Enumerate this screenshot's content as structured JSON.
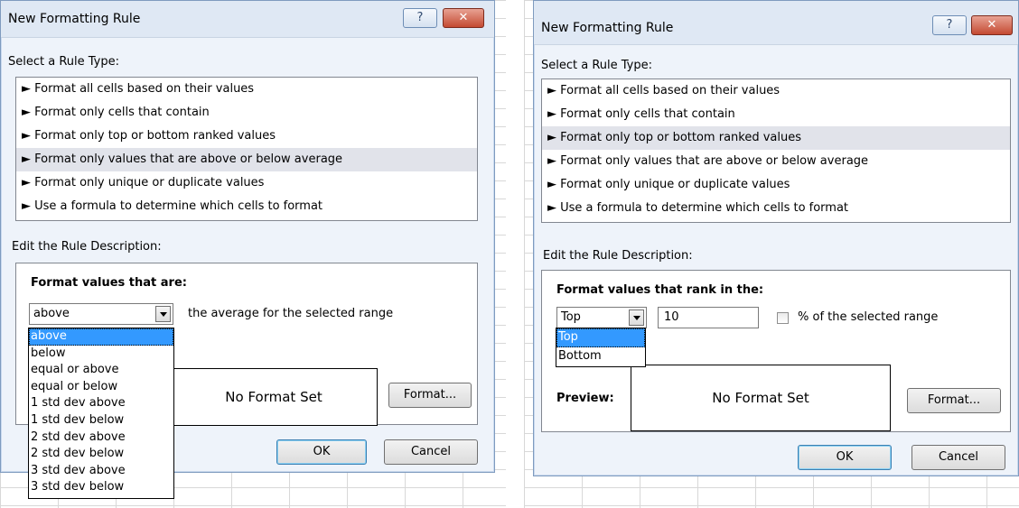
{
  "dialog1": {
    "title": "New Formatting Rule",
    "help": "?",
    "close": "✕",
    "select_rule_type": "Select a Rule Type:",
    "rule_types": [
      "► Format all cells based on their values",
      "► Format only cells that contain",
      "► Format only top or bottom ranked values",
      "► Format only values that are above or below average",
      "► Format only unique or duplicate values",
      "► Use a formula to determine which cells to format"
    ],
    "edit_rule_desc": "Edit the Rule Description:",
    "format_values_label": "Format values that are:",
    "combo_value": "above",
    "combo_suffix": "the average for the selected range",
    "dropdown_options": [
      "above",
      "below",
      "equal or above",
      "equal or below",
      "1 std dev above",
      "1 std dev below",
      "2 std dev above",
      "2 std dev below",
      "3 std dev above",
      "3 std dev below"
    ],
    "preview_text": "No Format Set",
    "format_button": "Format...",
    "ok": "OK",
    "cancel": "Cancel"
  },
  "dialog2": {
    "title": "New Formatting Rule",
    "help": "?",
    "close": "✕",
    "select_rule_type": "Select a Rule Type:",
    "rule_types": [
      "► Format all cells based on their values",
      "► Format only cells that contain",
      "► Format only top or bottom ranked values",
      "► Format only values that are above or below average",
      "► Format only unique or duplicate values",
      "► Use a formula to determine which cells to format"
    ],
    "edit_rule_desc": "Edit the Rule Description:",
    "format_values_label": "Format values that rank in the:",
    "combo_value": "Top",
    "rank_value": "10",
    "percent_label": "% of the selected range",
    "dropdown_options": [
      "Top",
      "Bottom"
    ],
    "preview_label": "Preview:",
    "preview_text": "No Format Set",
    "format_button": "Format...",
    "ok": "OK",
    "cancel": "Cancel"
  }
}
